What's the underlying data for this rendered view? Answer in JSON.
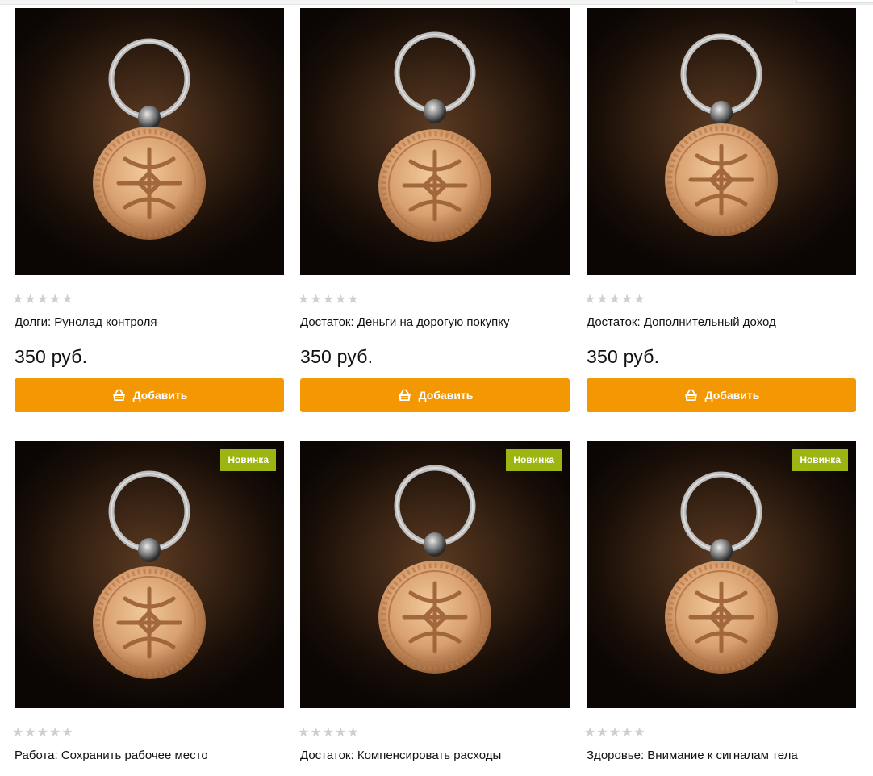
{
  "labels": {
    "add_button": "Добавить",
    "new_badge": "Новинка"
  },
  "products": [
    {
      "title": "Долги: Рунолад контроля",
      "price": "350 руб.",
      "rating": 0,
      "is_new": false
    },
    {
      "title": "Достаток: Деньги на дорогую покупку",
      "price": "350 руб.",
      "rating": 0,
      "is_new": false
    },
    {
      "title": "Достаток: Дополнительный доход",
      "price": "350 руб.",
      "rating": 0,
      "is_new": false
    },
    {
      "title": "Работа: Сохранить рабочее место",
      "price": "",
      "rating": 0,
      "is_new": true
    },
    {
      "title": "Достаток: Компенсировать расходы",
      "price": "",
      "rating": 0,
      "is_new": true
    },
    {
      "title": "Здоровье: Внимание к сигналам тела",
      "price": "",
      "rating": 0,
      "is_new": true
    }
  ],
  "colors": {
    "accent": "#f39702",
    "new_badge": "#9cb510",
    "star_empty": "#cfcfcf"
  },
  "icons": {
    "basket": "basket-icon",
    "star": "star-icon"
  }
}
